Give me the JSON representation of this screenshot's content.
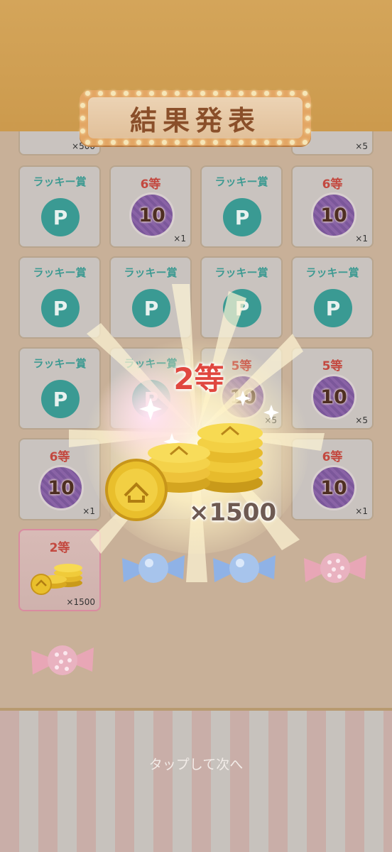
{
  "header": {
    "title": "結果発表"
  },
  "peek_row": {
    "left_qty": "×500",
    "right_qty": "×5"
  },
  "cards": [
    {
      "label": "ラッキー賞",
      "kind": "point",
      "glyph": "P"
    },
    {
      "label": "6等",
      "kind": "ticket",
      "value": "10",
      "qty": "×1"
    },
    {
      "label": "ラッキー賞",
      "kind": "point",
      "glyph": "P"
    },
    {
      "label": "6等",
      "kind": "ticket",
      "value": "10",
      "qty": "×1"
    },
    {
      "label": "ラッキー賞",
      "kind": "point",
      "glyph": "P"
    },
    {
      "label": "ラッキー賞",
      "kind": "point",
      "glyph": "P"
    },
    {
      "label": "ラッキー賞",
      "kind": "point",
      "glyph": "P"
    },
    {
      "label": "ラッキー賞",
      "kind": "point",
      "glyph": "P"
    },
    {
      "label": "ラッキー賞",
      "kind": "point",
      "glyph": "P"
    },
    {
      "label": "ラッキー賞",
      "kind": "point",
      "glyph": "P"
    },
    {
      "label": "5等",
      "kind": "ticket",
      "value": "10",
      "qty": "×5"
    },
    {
      "label": "5等",
      "kind": "ticket",
      "value": "10",
      "qty": "×5"
    },
    {
      "label": "6等",
      "kind": "ticket",
      "value": "10",
      "qty": "×1"
    },
    {
      "label": "",
      "kind": "hidden"
    },
    {
      "label": "",
      "kind": "hidden"
    },
    {
      "label": "6等",
      "kind": "ticket",
      "value": "10",
      "qty": "×1"
    }
  ],
  "highlight_card": {
    "label": "2等",
    "qty": "×1500"
  },
  "reveal": {
    "rank": "2等",
    "qty": "×1500"
  },
  "footer": {
    "tap_next": "タップして次へ"
  },
  "colors": {
    "point": "#3a9a93",
    "rank": "#e0473f",
    "lucky": "#3e9a92",
    "ticket": "#8a63a6"
  }
}
